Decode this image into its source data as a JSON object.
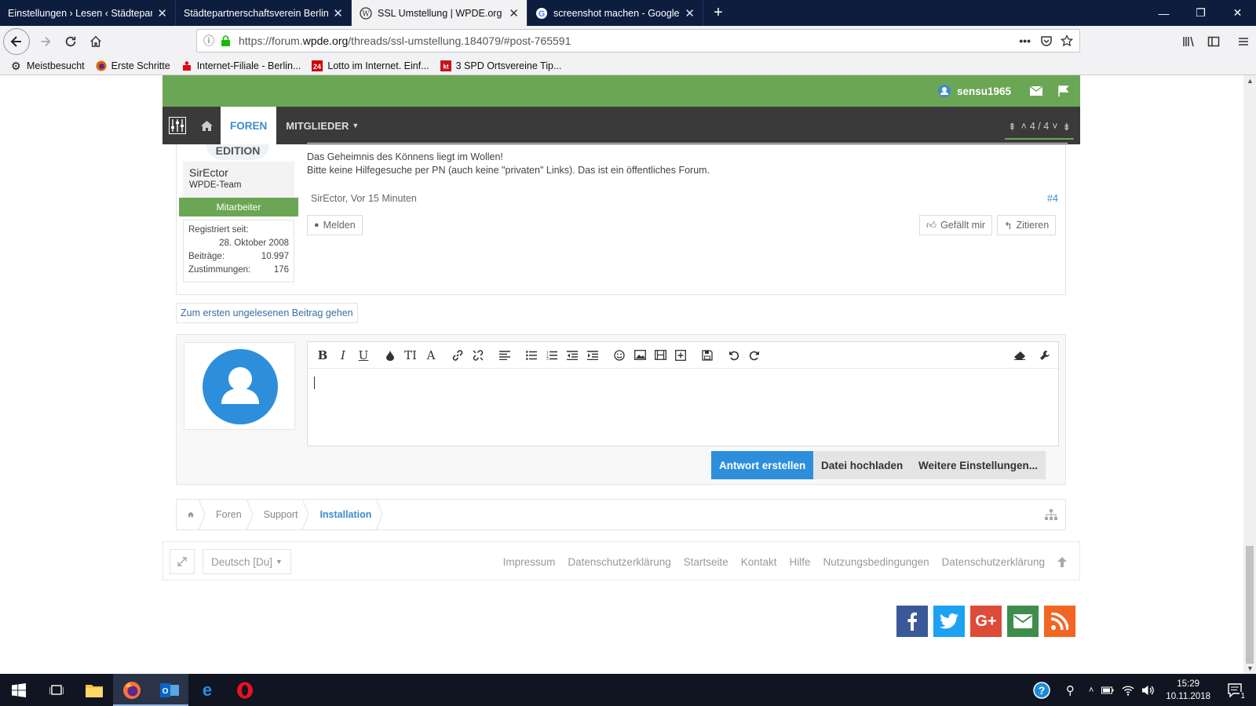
{
  "browser": {
    "tabs": [
      {
        "title": "Einstellungen › Lesen ‹ Städtepartne",
        "active": false
      },
      {
        "title": "Städtepartnerschaftsverein Berlin-M",
        "active": false
      },
      {
        "title": "SSL Umstellung | WPDE.org For",
        "active": true
      },
      {
        "title": "screenshot machen - Google-S",
        "active": false
      }
    ],
    "url_prefix": "https://forum.",
    "url_domain": "wpde.org",
    "url_path": "/threads/ssl-umstellung.184079/#post-765591",
    "bookmarks": [
      "Meistbesucht",
      "Erste Schritte",
      "Internet-Filiale - Berlin...",
      "Lotto im Internet. Einf...",
      "3 SPD Ortsvereine Tip..."
    ]
  },
  "header": {
    "username": "sensu1965"
  },
  "nav": {
    "foren": "FOREN",
    "mitglieder": "MITGLIEDER",
    "pager": "4 / 4"
  },
  "post": {
    "avatar_text": "EDITION",
    "author": "SirEctor",
    "role": "WPDE-Team",
    "badge": "Mitarbeiter",
    "registered_label": "Registriert seit:",
    "registered_value": "28. Oktober 2008",
    "posts_label": "Beiträge:",
    "posts_value": "10.997",
    "likes_label": "Zustimmungen:",
    "likes_value": "176",
    "sig_line1": "Das Geheimnis des Könnens liegt im Wollen!",
    "sig_line2": "Bitte keine Hilfegesuche per PN (auch keine \"privaten\" Links). Das ist ein öffentliches Forum.",
    "meta": "SirEctor, Vor 15 Minuten",
    "number": "#4",
    "report": "Melden",
    "like": "Gefällt mir",
    "quote": "Zitieren"
  },
  "unread_link": "Zum ersten ungelesenen Beitrag gehen",
  "editor": {
    "submit": "Antwort erstellen",
    "upload": "Datei hochladen",
    "more": "Weitere Einstellungen..."
  },
  "breadcrumb": [
    "Foren",
    "Support",
    "Installation"
  ],
  "footer": {
    "language": "Deutsch [Du]",
    "links": [
      "Impressum",
      "Datenschutzerklärung",
      "Startseite",
      "Kontakt",
      "Hilfe",
      "Nutzungsbedingungen",
      "Datenschutzerklärung"
    ]
  },
  "taskbar": {
    "time": "15:29",
    "date": "10.11.2018",
    "notifications": "1"
  },
  "colors": {
    "green": "#6ba654",
    "blue": "#3a8cd0",
    "dark": "#3a3a3a"
  }
}
